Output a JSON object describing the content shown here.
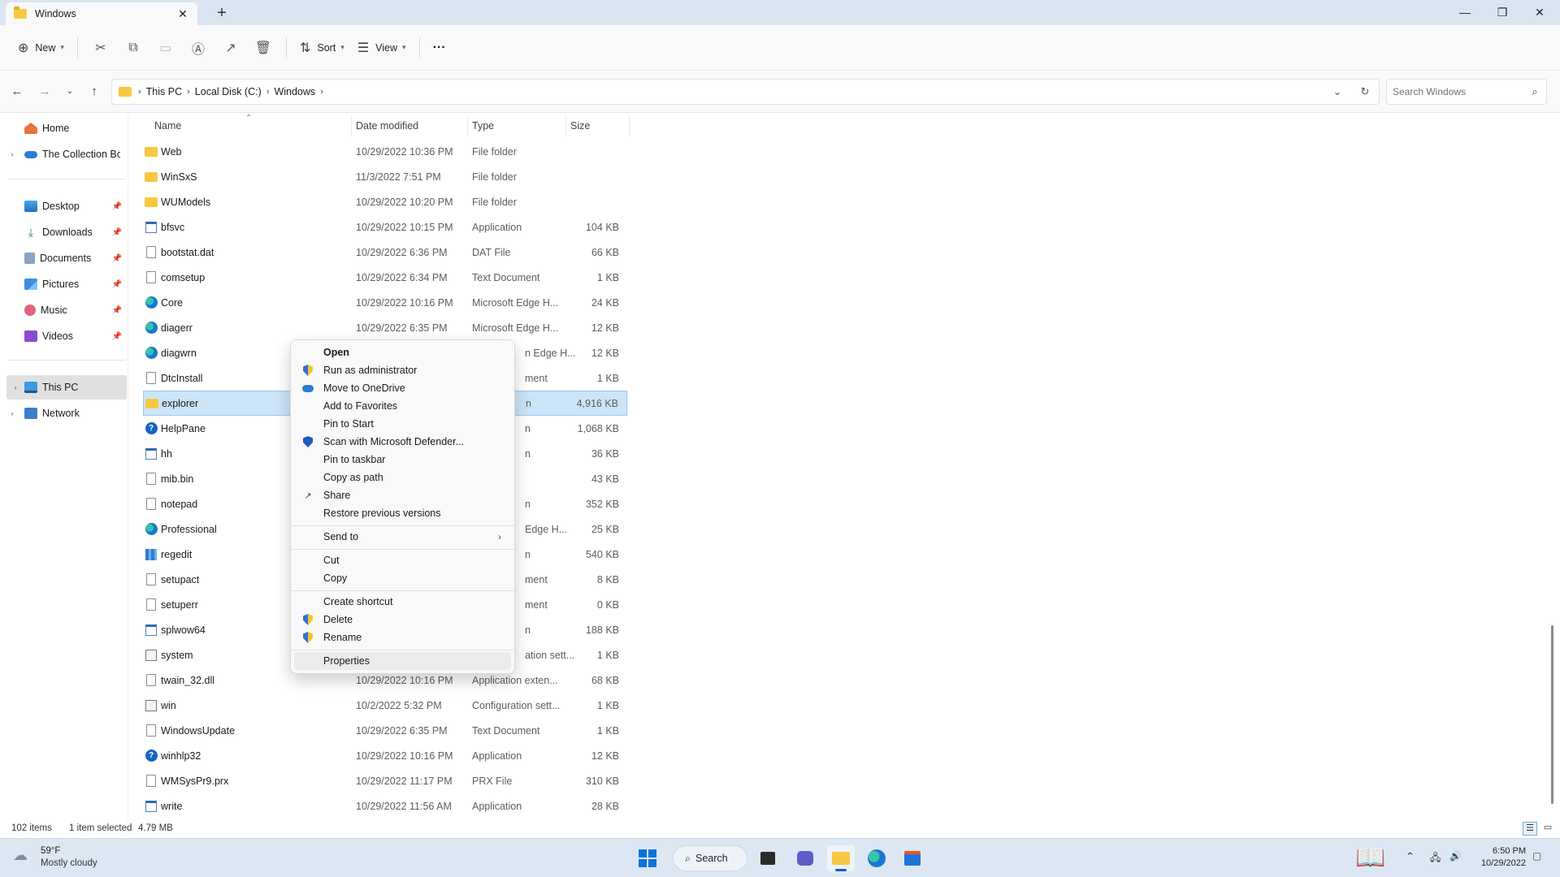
{
  "window": {
    "tab_title": "Windows",
    "tab_close": "✕",
    "new_tab": "+",
    "minimize": "—",
    "maximize": "❐",
    "close": "✕"
  },
  "commandbar": {
    "new_label": "New",
    "sort_label": "Sort",
    "view_label": "View",
    "more": "···"
  },
  "address": {
    "crumbs": [
      "This PC",
      "Local Disk (C:)",
      "Windows"
    ],
    "search_placeholder": "Search Windows"
  },
  "sidebar": {
    "home": "Home",
    "cloud": "The Collection Boo",
    "quick": [
      "Desktop",
      "Downloads",
      "Documents",
      "Pictures",
      "Music",
      "Videos"
    ],
    "this_pc": "This PC",
    "network": "Network"
  },
  "columns": {
    "name": "Name",
    "date": "Date modified",
    "type": "Type",
    "size": "Size"
  },
  "files": [
    {
      "name": "Web",
      "date": "10/29/2022 10:36 PM",
      "type": "File folder",
      "size": "",
      "icon": "folder"
    },
    {
      "name": "WinSxS",
      "date": "11/3/2022 7:51 PM",
      "type": "File folder",
      "size": "",
      "icon": "folder"
    },
    {
      "name": "WUModels",
      "date": "10/29/2022 10:20 PM",
      "type": "File folder",
      "size": "",
      "icon": "folder"
    },
    {
      "name": "bfsvc",
      "date": "10/29/2022 10:15 PM",
      "type": "Application",
      "size": "104 KB",
      "icon": "app"
    },
    {
      "name": "bootstat.dat",
      "date": "10/29/2022 6:36 PM",
      "type": "DAT File",
      "size": "66 KB",
      "icon": "doc"
    },
    {
      "name": "comsetup",
      "date": "10/29/2022 6:34 PM",
      "type": "Text Document",
      "size": "1 KB",
      "icon": "doc"
    },
    {
      "name": "Core",
      "date": "10/29/2022 10:16 PM",
      "type": "Microsoft Edge H...",
      "size": "24 KB",
      "icon": "edge"
    },
    {
      "name": "diagerr",
      "date": "10/29/2022 6:35 PM",
      "type": "Microsoft Edge H...",
      "size": "12 KB",
      "icon": "edge"
    },
    {
      "name": "diagwrn",
      "date": "",
      "type": "n Edge H...",
      "size": "12 KB",
      "icon": "edge"
    },
    {
      "name": "DtcInstall",
      "date": "",
      "type": "ment",
      "size": "1 KB",
      "icon": "doc"
    },
    {
      "name": "explorer",
      "date": "",
      "type": "n",
      "size": "4,916 KB",
      "icon": "folder"
    },
    {
      "name": "HelpPane",
      "date": "",
      "type": "n",
      "size": "1,068 KB",
      "icon": "help"
    },
    {
      "name": "hh",
      "date": "",
      "type": "n",
      "size": "36 KB",
      "icon": "app"
    },
    {
      "name": "mib.bin",
      "date": "",
      "type": "",
      "size": "43 KB",
      "icon": "doc"
    },
    {
      "name": "notepad",
      "date": "",
      "type": "n",
      "size": "352 KB",
      "icon": "doc"
    },
    {
      "name": "Professional",
      "date": "",
      "type": "Edge H...",
      "size": "25 KB",
      "icon": "edge"
    },
    {
      "name": "regedit",
      "date": "",
      "type": "n",
      "size": "540 KB",
      "icon": "reg"
    },
    {
      "name": "setupact",
      "date": "",
      "type": "ment",
      "size": "8 KB",
      "icon": "doc"
    },
    {
      "name": "setuperr",
      "date": "",
      "type": "ment",
      "size": "0 KB",
      "icon": "doc"
    },
    {
      "name": "splwow64",
      "date": "",
      "type": "n",
      "size": "188 KB",
      "icon": "app"
    },
    {
      "name": "system",
      "date": "",
      "type": "ation sett...",
      "size": "1 KB",
      "icon": "gear"
    },
    {
      "name": "twain_32.dll",
      "date": "10/29/2022 10:16 PM",
      "type": "Application exten...",
      "size": "68 KB",
      "icon": "doc"
    },
    {
      "name": "win",
      "date": "10/2/2022 5:32 PM",
      "type": "Configuration sett...",
      "size": "1 KB",
      "icon": "gear"
    },
    {
      "name": "WindowsUpdate",
      "date": "10/29/2022 6:35 PM",
      "type": "Text Document",
      "size": "1 KB",
      "icon": "doc"
    },
    {
      "name": "winhlp32",
      "date": "10/29/2022 10:16 PM",
      "type": "Application",
      "size": "12 KB",
      "icon": "help"
    },
    {
      "name": "WMSysPr9.prx",
      "date": "10/29/2022 11:17 PM",
      "type": "PRX File",
      "size": "310 KB",
      "icon": "doc"
    },
    {
      "name": "write",
      "date": "10/29/2022 11:56 AM",
      "type": "Application",
      "size": "28 KB",
      "icon": "app"
    }
  ],
  "context_menu": {
    "open": "Open",
    "run_as_admin": "Run as administrator",
    "move_onedrive": "Move to OneDrive",
    "add_favorites": "Add to Favorites",
    "pin_start": "Pin to Start",
    "scan_defender": "Scan with Microsoft Defender...",
    "pin_taskbar": "Pin to taskbar",
    "copy_path": "Copy as path",
    "share": "Share",
    "restore": "Restore previous versions",
    "send_to": "Send to",
    "cut": "Cut",
    "copy": "Copy",
    "create_shortcut": "Create shortcut",
    "delete": "Delete",
    "rename": "Rename",
    "properties": "Properties"
  },
  "statusbar": {
    "count": "102 items",
    "selected": "1 item selected",
    "size": "4.79 MB"
  },
  "taskbar": {
    "weather_temp": "59°F",
    "weather_desc": "Mostly cloudy",
    "search_label": "Search",
    "time": "6:50 PM",
    "date": "10/29/2022"
  }
}
